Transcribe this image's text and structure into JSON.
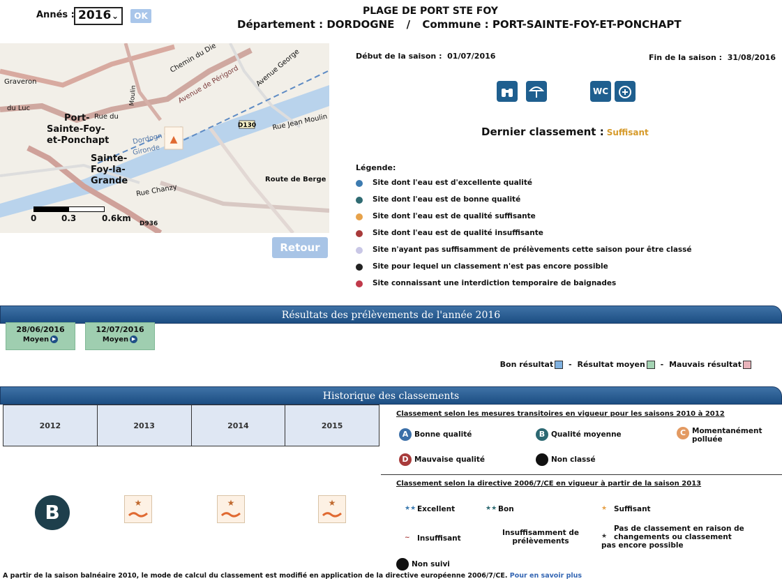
{
  "header": {
    "year_label": "Annés :",
    "year_value": "2016",
    "ok_label": "OK",
    "beach_title": "PLAGE DE PORT STE FOY",
    "department_label": "Département : DORDOGNE",
    "separator": "/",
    "commune_label": "Commune : PORT-SAINTE-FOY-ET-PONCHAPT"
  },
  "map": {
    "place_labels": [
      "Port-",
      "Sainte-Foy-",
      "et-Ponchapt",
      "Sainte-",
      "Foy-la-",
      "Grande",
      "Rue du",
      "du Luc",
      "Graveron",
      "Dordogn",
      "Gironde",
      "Rue Chanzy",
      "Route de Berge",
      "Rue Jean Moulin",
      "Chemin du Die",
      "Avenue de Périgord",
      "Avenue George",
      "D130",
      "D936",
      "Moulin"
    ],
    "scale_labels": [
      "0",
      "0.3",
      "0.6km"
    ],
    "retour_label": "Retour"
  },
  "season": {
    "start_label": "Début de la saison :",
    "start_value": "01/07/2016",
    "end_label": "Fin de la saison :",
    "end_value": "31/08/2016"
  },
  "facility_icons": [
    "binoculars-icon",
    "parasol-icon",
    "wc-icon",
    "first-aid-icon"
  ],
  "last_classification": {
    "label": "Dernier classement :",
    "value": "Suffisant",
    "value_color": "#d69a2a"
  },
  "legend": {
    "title": "Légende:",
    "items": [
      {
        "text": "Site dont l'eau est d'excellente qualité",
        "color": "#3d7bb0"
      },
      {
        "text": "Site dont l'eau est de bonne qualité",
        "color": "#2f6b72"
      },
      {
        "text": "Site dont l'eau est de qualité suffisante",
        "color": "#e7a24a"
      },
      {
        "text": "Site dont l'eau est de qualité insuffisante",
        "color": "#a83a3a"
      },
      {
        "text": "Site n'ayant pas suffisamment de prélèvements cette saison pour être classé",
        "color": "#c9c7e6"
      },
      {
        "text": "Site pour lequel un classement n'est pas encore possible",
        "color": "#222222"
      },
      {
        "text": "Site connaissant une interdiction temporaire de baignades",
        "color": "#c0394a"
      }
    ]
  },
  "results": {
    "title": "Résultats des prélèvements de l'année 2016",
    "samples": [
      {
        "date": "28/06/2016",
        "quality": "Moyen"
      },
      {
        "date": "12/07/2016",
        "quality": "Moyen"
      }
    ],
    "key": {
      "good": "Bon résultat",
      "medium": "Résultat moyen",
      "bad": "Mauvais résultat",
      "separator": "-"
    }
  },
  "history": {
    "title": "Historique des classements",
    "years": [
      "2012",
      "2013",
      "2014",
      "2015"
    ],
    "badge": "B"
  },
  "classification_old": {
    "title": "Classement selon les mesures transitoires en vigueur pour les saisons 2010 à 2012",
    "items": [
      {
        "letter": "A",
        "label": "Bonne qualité",
        "color": "#3b6fa8"
      },
      {
        "letter": "B",
        "label": "Qualité moyenne",
        "color": "#2c6872"
      },
      {
        "letter": "C",
        "label": "Momentanément polluée",
        "color": "#e39a62"
      },
      {
        "letter": "D",
        "label": "Mauvaise qualité",
        "color": "#a83b3b"
      },
      {
        "letter": "",
        "label": "Non classé",
        "color": "#111111"
      }
    ]
  },
  "classification_new": {
    "title": "Classement selon la directive 2006/7/CE en vigueur à partir de la saison 2013",
    "items": {
      "excellent": "Excellent",
      "bon": "Bon",
      "suffisant": "Suffisant",
      "insuffisant": "Insuffisant",
      "insuffisamment": "Insuffisamment de prélèvements",
      "pas_de_classement": "Pas de classement en raison de changements ou classement pas encore possible",
      "non_suivi": "Non suivi"
    }
  },
  "footer": {
    "text": "A partir de la saison balnéaire 2010, le mode de calcul du classement est modifié en application de la directive européenne 2006/7/CE.",
    "link": "Pour en savoir plus"
  }
}
